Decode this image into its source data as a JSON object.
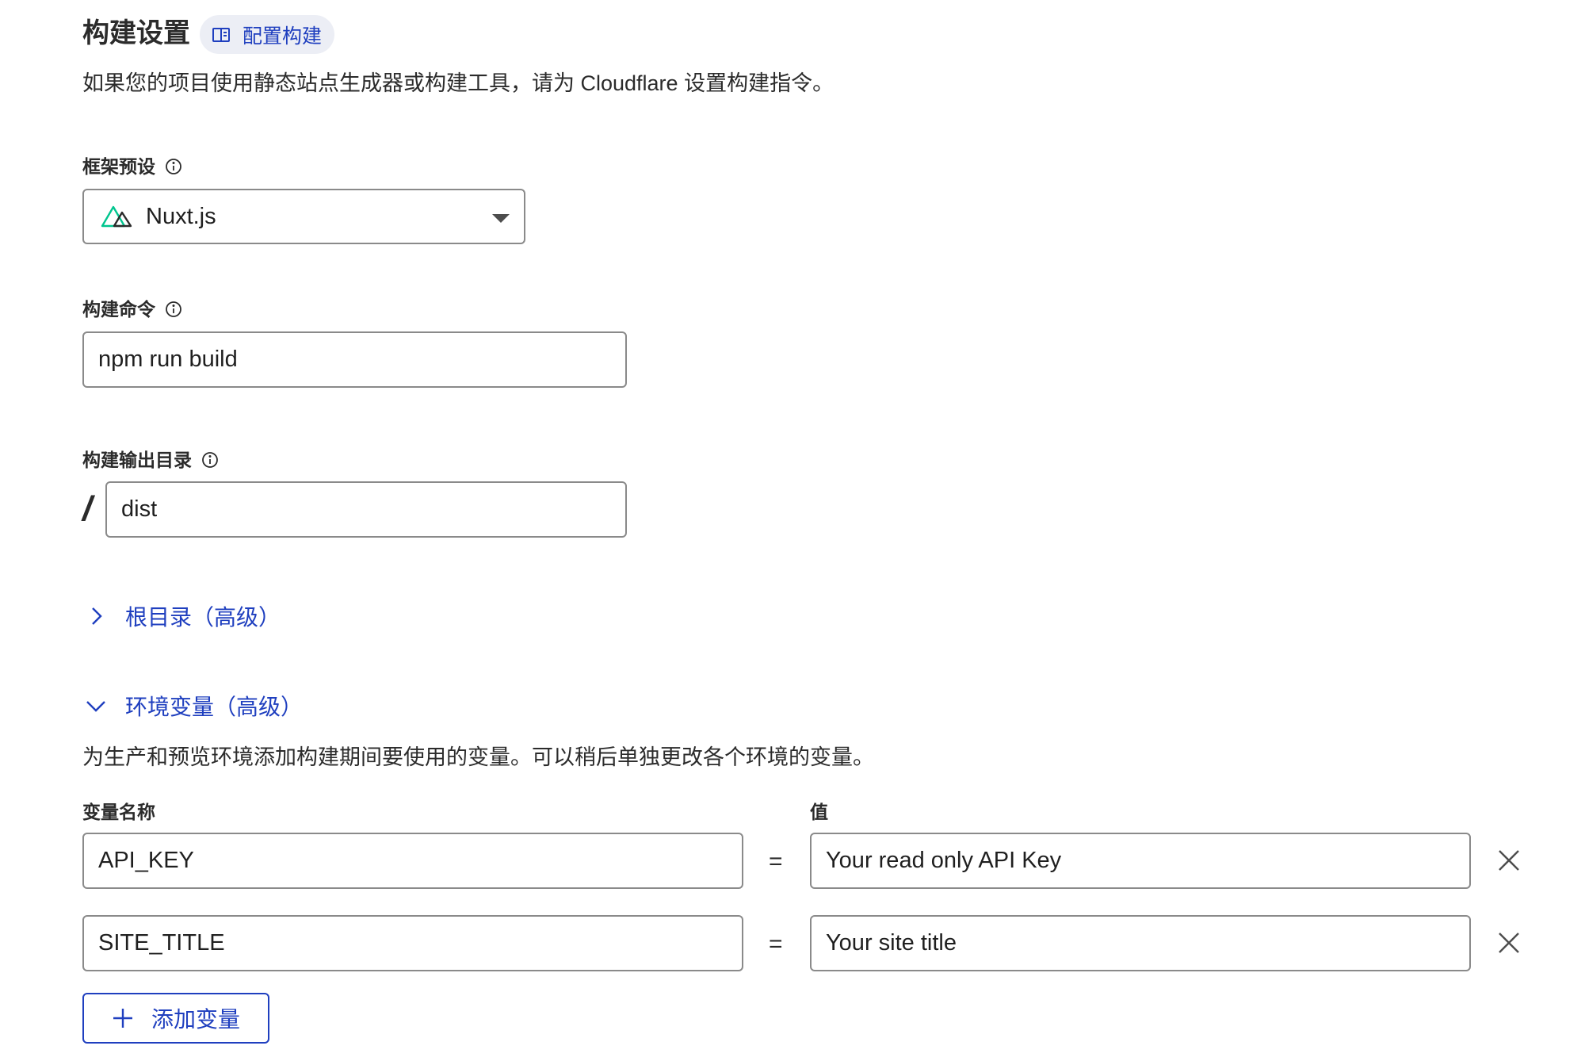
{
  "header": {
    "title": "构建设置",
    "doc_link_label": "配置构建",
    "description": "如果您的项目使用静态站点生成器或构建工具，请为 Cloudflare 设置构建指令。"
  },
  "framework_preset": {
    "label": "框架预设",
    "selected": "Nuxt.js",
    "icon": "nuxt-logo-icon",
    "accent_color": "#00c58e"
  },
  "build_command": {
    "label": "构建命令",
    "value": "npm run build"
  },
  "build_output": {
    "label": "构建输出目录",
    "prefix": "/",
    "value": "dist"
  },
  "root_directory": {
    "label": "根目录（高级）",
    "expanded": false
  },
  "env_vars": {
    "label": "环境变量（高级）",
    "expanded": true,
    "description": "为生产和预览环境添加构建期间要使用的变量。可以稍后单独更改各个环境的变量。",
    "name_header": "变量名称",
    "value_header": "值",
    "equals": "=",
    "rows": [
      {
        "name": "API_KEY",
        "value": "Your read only API Key"
      },
      {
        "name": "SITE_TITLE",
        "value": "Your site title"
      }
    ],
    "add_label": "添加变量"
  },
  "colors": {
    "link_blue": "#1f3fbf",
    "pill_bg": "#eceef5",
    "border_gray": "#8a8a8a"
  }
}
